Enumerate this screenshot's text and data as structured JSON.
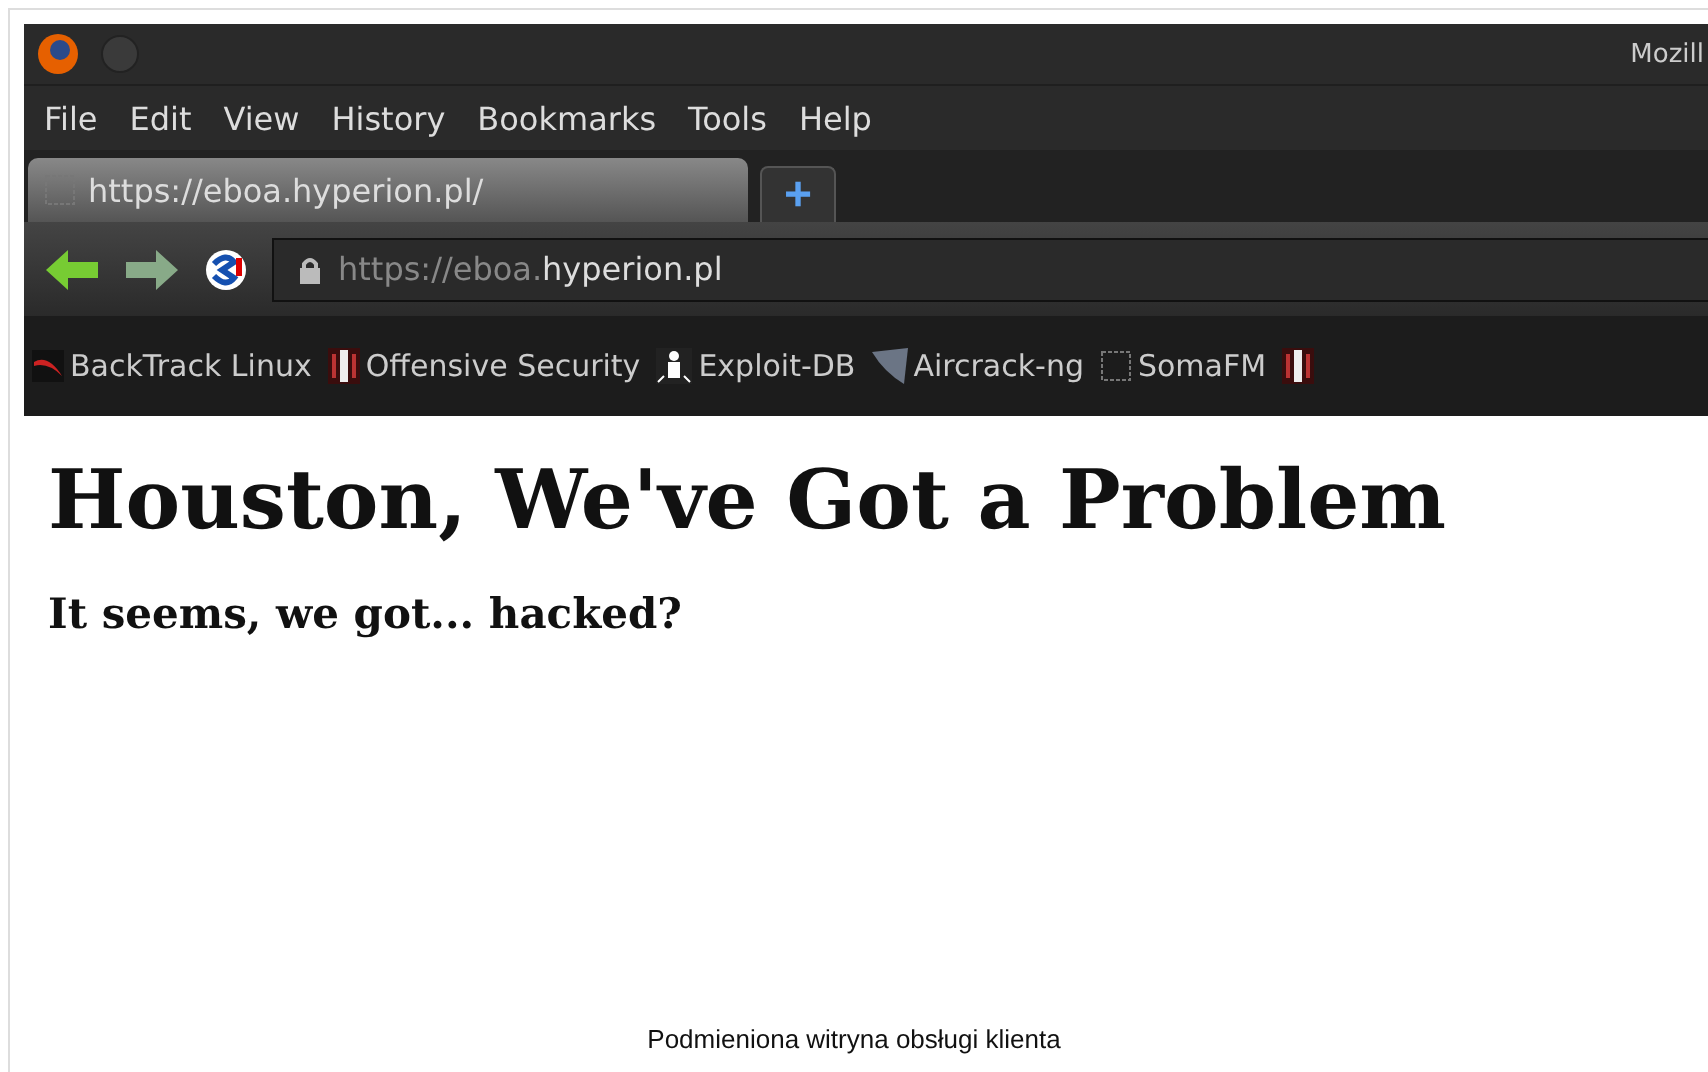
{
  "window": {
    "title": "Mozill"
  },
  "menu": [
    "File",
    "Edit",
    "View",
    "History",
    "Bookmarks",
    "Tools",
    "Help"
  ],
  "tabs": [
    {
      "label": "https://eboa.hyperion.pl/",
      "selected": true
    }
  ],
  "new_tab": "+",
  "address": {
    "dim": "https://eboa.",
    "host": "hyperion.pl"
  },
  "bookmarks": [
    {
      "label": "BackTrack Linux",
      "kind": "dragon"
    },
    {
      "label": "Offensive Security",
      "kind": "tower"
    },
    {
      "label": "Exploit-DB",
      "kind": "person"
    },
    {
      "label": "Aircrack-ng",
      "kind": "wing"
    },
    {
      "label": "SomaFM",
      "kind": "blank"
    },
    {
      "kind": "tower"
    }
  ],
  "page": {
    "heading": "Houston, We've Got a Problem",
    "subheading": "It seems, we got... hacked?"
  },
  "caption": "Podmieniona witryna obsługi klienta"
}
